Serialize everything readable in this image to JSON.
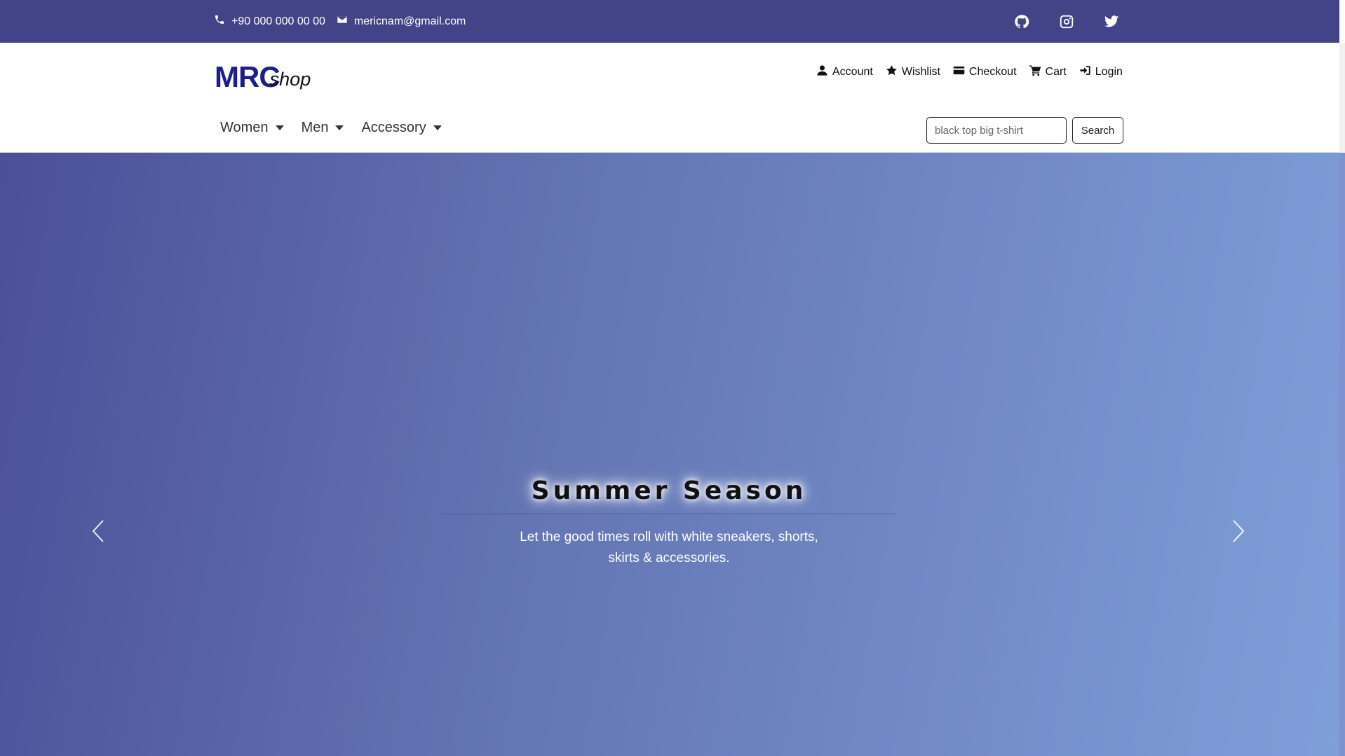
{
  "topbar": {
    "phone": "+90 000 000 00 00",
    "email": "mericnam@gmail.com",
    "social": [
      "github-icon",
      "instagram-icon",
      "twitter-icon"
    ],
    "background": "#434488"
  },
  "header": {
    "logo": {
      "primary": "MRC",
      "secondary": "shop",
      "color": "#1c1f8a"
    },
    "user_nav": {
      "account": "Account",
      "wishlist": "Wishlist",
      "checkout": "Checkout",
      "cart": "Cart",
      "login": "Login"
    },
    "categories": [
      "Women",
      "Men",
      "Accessory"
    ],
    "search": {
      "placeholder": "black top big t-shirt",
      "button": "Search"
    }
  },
  "hero": {
    "title": "Summer Season",
    "subtitle": "Let the good times roll with white sneakers, shorts, skirts & accessories.",
    "gradient": [
      "#4b4f98",
      "#6374b2",
      "#7f9fd9"
    ]
  }
}
